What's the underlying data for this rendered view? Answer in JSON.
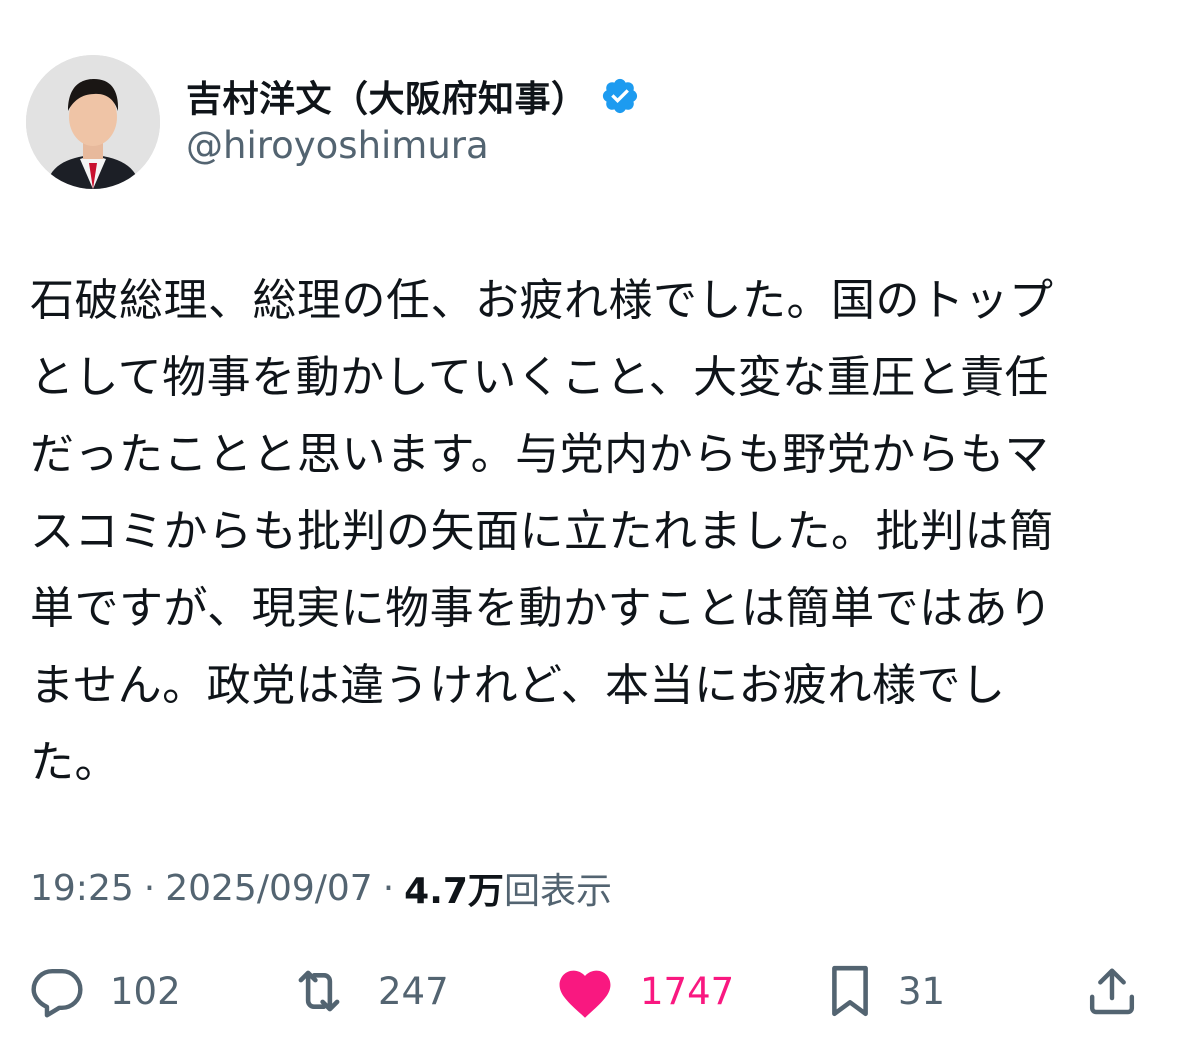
{
  "author": {
    "display_name": "吉村洋文（大阪府知事）",
    "handle": "@hiroyoshimura",
    "verified_icon": "verified-badge-icon",
    "verified_color": "#1d9bf0"
  },
  "tweet": {
    "text": "石破総理、総理の任、お疲れ様でした。国のトップ\nとして物事を動かしていくこと、大変な重圧と責任\nだったことと思います。与党内からも野党からもマ\nスコミからも批判の矢面に立たれました。批判は簡\n単ですが、現実に物事を動かすことは簡単ではあり\nません。政党は違うけれど、本当にお疲れ様でし\nた。"
  },
  "meta": {
    "time": "19:25",
    "separator": "·",
    "date": "2025/09/07",
    "views_count": "4.7万",
    "views_label": "回表示"
  },
  "actions": {
    "reply": {
      "icon": "reply-icon",
      "count": "102"
    },
    "retweet": {
      "icon": "retweet-icon",
      "count": "247"
    },
    "like": {
      "icon": "heart-icon",
      "count": "1747",
      "color": "#f91880"
    },
    "bookmark": {
      "icon": "bookmark-icon",
      "count": "31"
    },
    "share": {
      "icon": "share-icon"
    }
  },
  "colors": {
    "text": "#0f1419",
    "secondary": "#536471",
    "like": "#f91880",
    "verified": "#1d9bf0"
  }
}
